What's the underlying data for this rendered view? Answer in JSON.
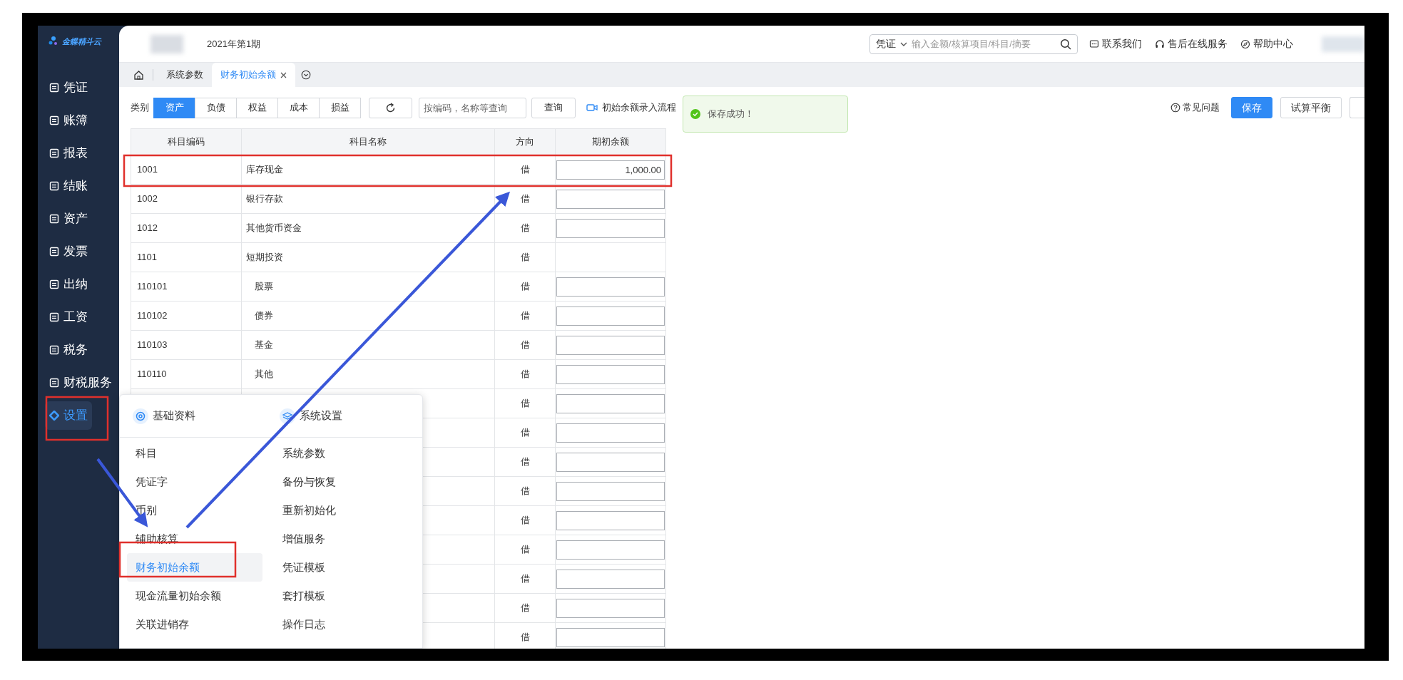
{
  "sidebar": {
    "logo": "金蝶精斗云",
    "items": [
      {
        "label": "凭证",
        "selected": false
      },
      {
        "label": "账簿",
        "selected": false
      },
      {
        "label": "报表",
        "selected": false
      },
      {
        "label": "结账",
        "selected": false
      },
      {
        "label": "资产",
        "selected": false
      },
      {
        "label": "发票",
        "selected": false
      },
      {
        "label": "出纳",
        "selected": false
      },
      {
        "label": "工资",
        "selected": false
      },
      {
        "label": "税务",
        "selected": false
      },
      {
        "label": "财税服务",
        "selected": false
      },
      {
        "label": "设置",
        "selected": true
      }
    ]
  },
  "header": {
    "period": "2021年第1期",
    "search": {
      "scope": "凭证",
      "placeholder": "输入金额/核算项目/科目/摘要"
    },
    "links": [
      "联系我们",
      "售后在线服务",
      "帮助中心"
    ]
  },
  "tabs": [
    {
      "label": "系统参数",
      "selected": false,
      "closable": false
    },
    {
      "label": "财务初始余额",
      "selected": true,
      "closable": true
    }
  ],
  "toolbar": {
    "category_label": "类别",
    "categories": [
      {
        "label": "资产",
        "selected": true
      },
      {
        "label": "负债",
        "selected": false
      },
      {
        "label": "权益",
        "selected": false
      },
      {
        "label": "成本",
        "selected": false
      },
      {
        "label": "损益",
        "selected": false
      }
    ],
    "search": {
      "placeholder": "按编码，名称等查询"
    },
    "query_button": "查询",
    "guide_link": "初始余额录入流程",
    "help_link": "常见问题",
    "buttons": [
      {
        "label": "保存",
        "primary": true
      },
      {
        "label": "试算平衡",
        "primary": false
      }
    ]
  },
  "toast": {
    "message": "保存成功！"
  },
  "table": {
    "columns": [
      "科目编码",
      "科目名称",
      "方向",
      "期初余额"
    ],
    "rows": [
      {
        "code": "1001",
        "name": "库存现金",
        "direction": "借",
        "editable": true,
        "balance": "1,000.00"
      },
      {
        "code": "1002",
        "name": "银行存款",
        "direction": "借",
        "editable": true
      },
      {
        "code": "1012",
        "name": "其他货币资金",
        "direction": "借",
        "editable": true
      },
      {
        "code": "1101",
        "name": "短期投资",
        "direction": "借",
        "editable": false,
        "children": [
          {
            "code": "110101",
            "name": "股票",
            "direction": "借",
            "editable": true
          },
          {
            "code": "110102",
            "name": "债券",
            "direction": "借",
            "editable": true
          },
          {
            "code": "110103",
            "name": "基金",
            "direction": "借",
            "editable": true
          },
          {
            "code": "110110",
            "name": "其他",
            "direction": "借",
            "editable": true
          }
        ]
      },
      {
        "direction": "借",
        "editable": true
      },
      {
        "direction": "借",
        "editable": true
      },
      {
        "direction": "借",
        "editable": true
      },
      {
        "direction": "借",
        "editable": true
      },
      {
        "direction": "借",
        "editable": true
      },
      {
        "direction": "借",
        "editable": true
      },
      {
        "direction": "借",
        "editable": true
      },
      {
        "direction": "借",
        "editable": true
      },
      {
        "direction": "借",
        "editable": true
      }
    ]
  },
  "settings_menu": {
    "sections": [
      {
        "title": "基础资料",
        "items": [
          {
            "label": "科目",
            "selected": false
          },
          {
            "label": "凭证字",
            "selected": false
          },
          {
            "label": "币别",
            "selected": false
          },
          {
            "label": "辅助核算",
            "selected": false
          },
          {
            "label": "财务初始余额",
            "selected": true
          },
          {
            "label": "现金流量初始余额",
            "selected": false
          },
          {
            "label": "关联进销存",
            "selected": false
          }
        ]
      },
      {
        "title": "系统设置",
        "items": [
          {
            "label": "系统参数",
            "selected": false
          },
          {
            "label": "备份与恢复",
            "selected": false
          },
          {
            "label": "重新初始化",
            "selected": false
          },
          {
            "label": "增值服务",
            "selected": false
          },
          {
            "label": "凭证模板",
            "selected": false
          },
          {
            "label": "套打模板",
            "selected": false
          },
          {
            "label": "操作日志",
            "selected": false
          }
        ]
      }
    ]
  }
}
